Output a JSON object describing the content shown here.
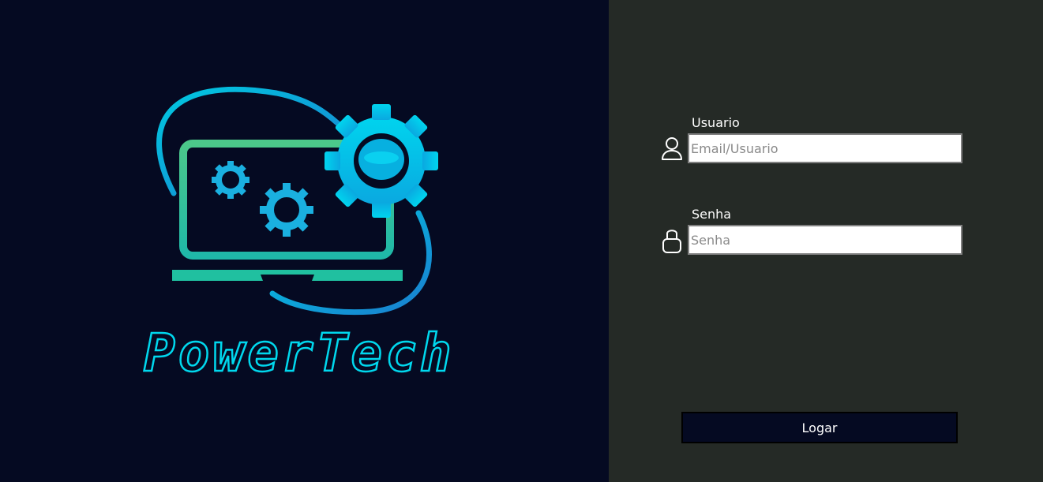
{
  "brand": {
    "logo_text": "PowerTech",
    "colors": {
      "background_left": "#050a22",
      "background_right": "#252a26",
      "accent_cyan": "#00c8e8",
      "accent_green": "#3cc880"
    }
  },
  "login_form": {
    "username": {
      "label": "Usuario",
      "placeholder": "Email/Usuario",
      "value": "",
      "icon": "user-icon"
    },
    "password": {
      "label": "Senha",
      "placeholder": "Senha",
      "value": "",
      "icon": "lock-icon"
    },
    "submit_label": "Logar"
  }
}
